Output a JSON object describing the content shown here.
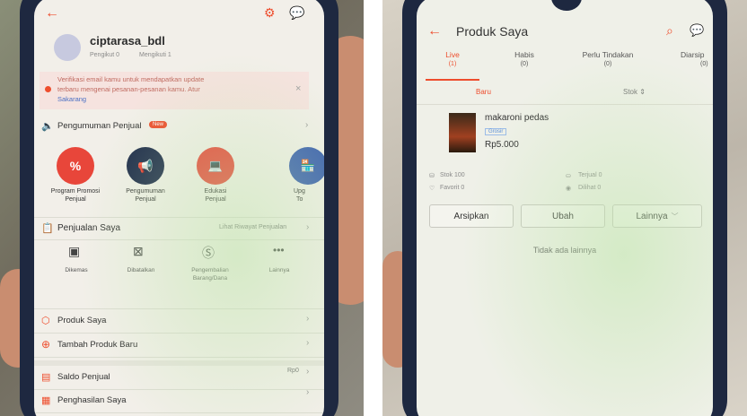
{
  "left": {
    "username": "ciptarasa_bdl",
    "followers": "Pengikut 0",
    "following": "Mengikuti 1",
    "verify_banner": {
      "line1": "Verifikasi email kamu untuk mendapatkan update",
      "line2": "terbaru mengenai pesanan-pesanan kamu. Atur",
      "link": "Sakarang"
    },
    "announcement": {
      "label": "Pengumuman Penjual",
      "badge": "New"
    },
    "quick_actions": [
      {
        "label1": "Program Promosi",
        "label2": "Penjual",
        "icon": "percent-tag-icon",
        "color": "#e8463a"
      },
      {
        "label1": "Pengumuman",
        "label2": "Penjual",
        "icon": "megaphone-icon",
        "color": "#1d2a4a"
      },
      {
        "label1": "Edukasi",
        "label2": "Penjual",
        "icon": "laptop-icon",
        "color": "#e8463a"
      },
      {
        "label1": "Upg",
        "label2": "To",
        "icon": "store-icon",
        "color": "#3b5fb0"
      }
    ],
    "sales": {
      "title": "Penjualan Saya",
      "history_link": "Lihat Riwayat Penjualan"
    },
    "sales_items": [
      {
        "label1": "Dikemas",
        "label2": "",
        "icon": "box-icon"
      },
      {
        "label1": "Dibatalkan",
        "label2": "",
        "icon": "cancel-box-icon"
      },
      {
        "label1": "Pengembalian",
        "label2": "Barang/Dana",
        "icon": "refund-icon"
      },
      {
        "label1": "Lainnya",
        "label2": "",
        "icon": "more-icon"
      }
    ],
    "menu": [
      {
        "label": "Produk Saya",
        "icon": "cube-icon",
        "value": ""
      },
      {
        "label": "Tambah Produk Baru",
        "icon": "plus-circle-icon",
        "value": ""
      },
      {
        "label": "Saldo Penjual",
        "icon": "wallet-icon",
        "value": "Rp0"
      },
      {
        "label": "Penghasilan Saya",
        "icon": "income-icon",
        "value": ""
      }
    ]
  },
  "right": {
    "title": "Produk Saya",
    "tabs": [
      {
        "label": "Live",
        "count": "(1)"
      },
      {
        "label": "Habis",
        "count": "(0)"
      },
      {
        "label": "Perlu Tindakan",
        "count": "(0)"
      },
      {
        "label": "Diarsip",
        "count": "(0)"
      }
    ],
    "sort": {
      "newest": "Baru",
      "stock": "Stok ⇕"
    },
    "product": {
      "name": "makaroni pedas",
      "tag": "Grosir",
      "price": "Rp5.000",
      "stock": "Stok 100",
      "sold": "Terjual 0",
      "favorite": "Favorit 0",
      "views": "Dilihat 0"
    },
    "actions": {
      "archive": "Arsipkan",
      "edit": "Ubah",
      "more": "Lainnya"
    },
    "empty_text": "Tidak ada lainnya"
  }
}
